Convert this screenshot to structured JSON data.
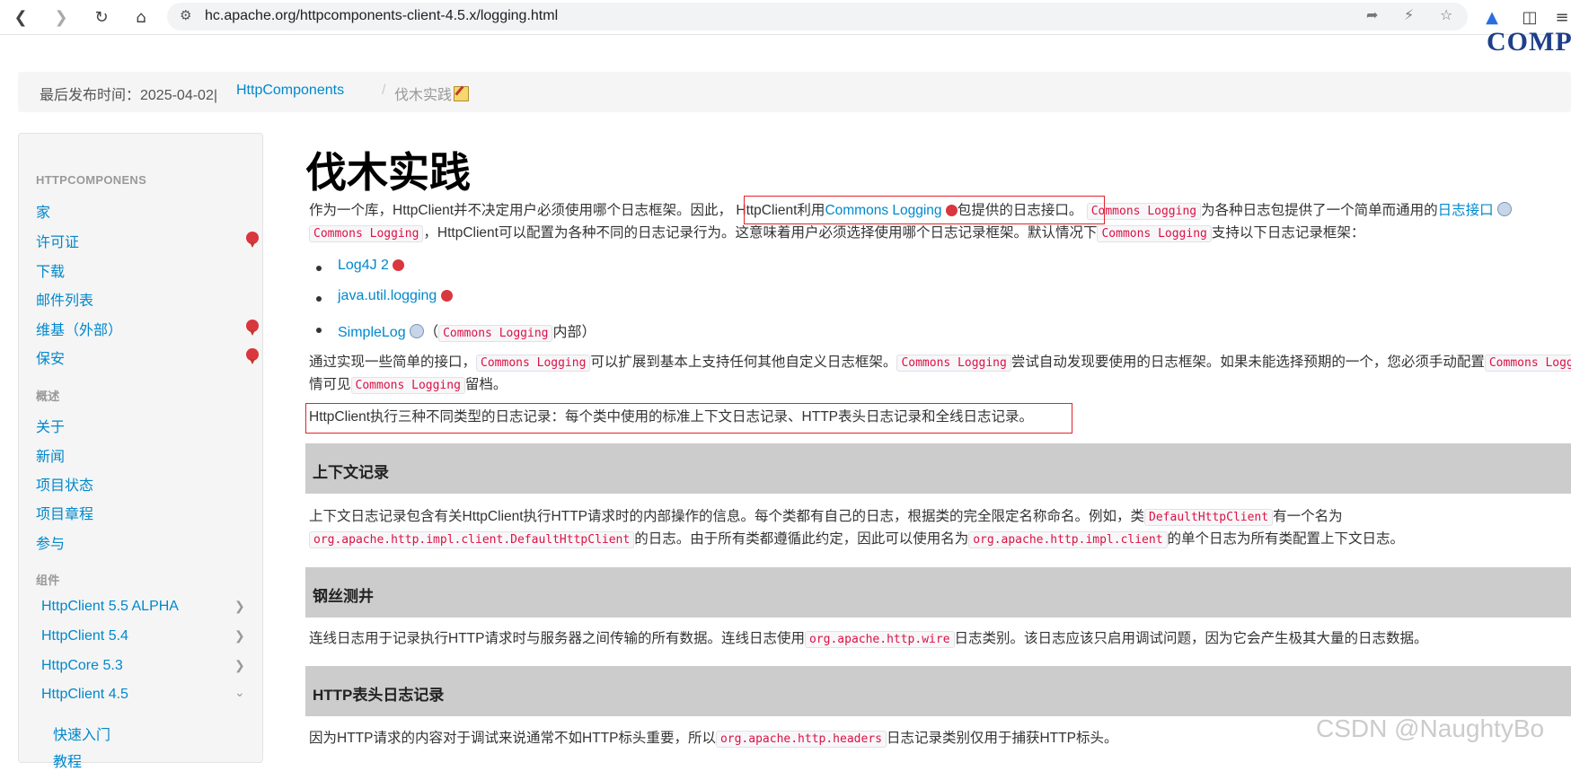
{
  "browser": {
    "url": "hc.apache.org/httpcomponents-client-4.5.x/logging.html"
  },
  "logo_text": "COMP",
  "breadcrumb": {
    "published": "最后发布时间：2025-04-02|",
    "home": "HttpComponents",
    "sep": "/",
    "current": "伐木实践"
  },
  "sidebar": {
    "header1": "HTTPCOMPONENS",
    "items1": [
      "家",
      "许可证",
      "下载",
      "邮件列表",
      "维基（外部）",
      "保安"
    ],
    "header2": "概述",
    "items2": [
      "关于",
      "新闻",
      "项目状态",
      "项目章程",
      "参与"
    ],
    "header3": "组件",
    "items3": [
      "HttpClient 5.5 ALPHA",
      "HttpClient 5.4",
      "HttpCore 5.3",
      "HttpClient 4.5"
    ],
    "items4": [
      "快速入门",
      "教程"
    ]
  },
  "main": {
    "title": "伐木实践",
    "p1": {
      "a": "作为一个库，HttpClient并不决定用户必须使用哪个日志框架。因此，",
      "b": "HttpClient利用",
      "link": "Commons Logging",
      "c": "包提供的日志接口",
      "d": "。",
      "code1": "Commons Logging",
      "e": "为各种日志包提供了一个简单而通用的",
      "link2": "日志接口",
      "code2": "Commons Logging",
      "f": "，HttpClient可以配置为各种不同的日志记录行为。这意味着用户必须选择使用哪个日志记录框架。默认情况下",
      "code3": "Commons Logging",
      "g": "支持以下日志记录框架："
    },
    "list": {
      "item1": "Log4J 2",
      "item2": "java.util.logging",
      "item3": "SimpleLog",
      "item3_paren_open": "（",
      "item3_code": "Commons Logging",
      "item3_rest": "内部）"
    },
    "p2": {
      "a": "通过实现一些简单的接口，",
      "code1": "Commons Logging",
      "b": "可以扩展到基本上支持任何其他自定义日志框架。",
      "code2": "Commons Logging",
      "c": "尝试自动发现要使用的日志框架。如果未能选择预期的一个，您必须手动配置",
      "code3": "Commons Logging",
      "d": "情可见",
      "code4": "Commons Logging",
      "e": "留档。"
    },
    "p3": "HttpClient执行三种不同类型的日志记录：每个类中使用的标准上下文日志记录、HTTP表头日志记录和全线日志记录。",
    "section1": {
      "title": "上下文记录",
      "a": "上下文日志记录包含有关HttpClient执行HTTP请求时的内部操作的信息。每个类都有自己的日志，根据类的完全限定名称命名。例如，类",
      "code1": "DefaultHttpClient",
      "b": "有一个名为",
      "code2": "org.apache.http.impl.client.DefaultHttpClient",
      "c": "的日志。由于所有类都遵循此约定，因此可以使用名为",
      "code3": "org.apache.http.impl.client",
      "d": "的单个日志为所有类配置上下文日志。"
    },
    "section2": {
      "title": "钢丝测井",
      "a": "连线日志用于记录执行HTTP请求时与服务器之间传输的所有数据。连线日志使用",
      "code1": "org.apache.http.wire",
      "b": "日志类别。该日志应该只启用调试问题，因为它会产生极其大量的日志数据。"
    },
    "section3": {
      "title": "HTTP表头日志记录",
      "a": "因为HTTP请求的内容对于调试来说通常不如HTTP标头重要，所以",
      "code1": "org.apache.http.headers",
      "b": "日志记录类别仅用于捕获HTTP标头。"
    }
  },
  "watermark": "CSDN @NaughtyBo"
}
